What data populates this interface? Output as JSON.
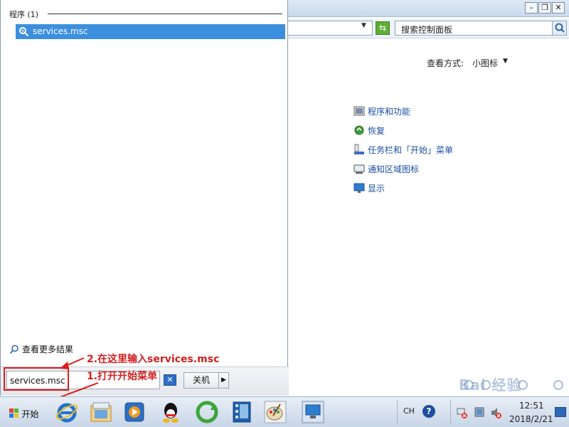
{
  "control_panel": {
    "search_placeholder": "搜索控制面板",
    "view_by_label": "查看方式:",
    "view_by_value": "小图标",
    "items": [
      {
        "label": "程序和功能",
        "icon": "programs-icon"
      },
      {
        "label": "恢复",
        "icon": "recovery-icon"
      },
      {
        "label": "任务栏和「开始」菜单",
        "icon": "taskbar-icon"
      },
      {
        "label": "通知区域图标",
        "icon": "notification-icon"
      },
      {
        "label": "显示",
        "icon": "display-icon"
      }
    ]
  },
  "start_menu": {
    "section_label": "程序 (1)",
    "result_label": "services.msc",
    "more_results_label": "查看更多结果",
    "search_value": "services.msc",
    "shutdown_label": "关机"
  },
  "annotations": {
    "step2": "2.在这里输入services.msc",
    "step1": "1.打开开始菜单"
  },
  "taskbar": {
    "start_label": "开始",
    "pinned": [
      "ie-icon",
      "explorer-icon",
      "media-player-icon",
      "qq-icon",
      "refresh-app-icon",
      "video-icon",
      "paint-icon",
      "remote-desktop-icon"
    ],
    "tray": {
      "lang": "CH",
      "time": "12:51",
      "date": "2018/2/21"
    }
  },
  "watermark": {
    "text": "Bai 经验"
  },
  "colors": {
    "selection": "#3c8fde",
    "annotation": "#e01c1c",
    "link": "#1a4fa3"
  }
}
